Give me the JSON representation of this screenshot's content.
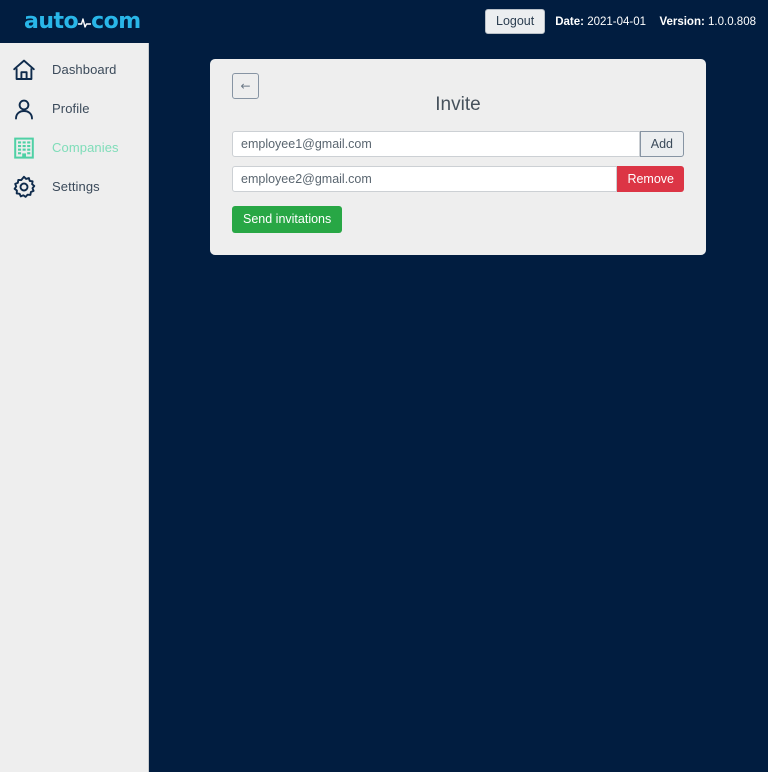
{
  "header": {
    "logo": {
      "text_left": "auto",
      "text_right": "com",
      "icon": "wave-pulse-icon",
      "color": "#29b6e8"
    },
    "logout_label": "Logout",
    "date_label": "Date:",
    "date_value": "2021-04-01",
    "version_label": "Version:",
    "version_value": "1.0.0.808"
  },
  "sidebar": {
    "items": [
      {
        "label": "Dashboard",
        "icon": "home-icon",
        "active": false
      },
      {
        "label": "Profile",
        "icon": "user-icon",
        "active": false
      },
      {
        "label": "Companies",
        "icon": "building-icon",
        "active": true
      },
      {
        "label": "Settings",
        "icon": "gear-icon",
        "active": false
      }
    ],
    "active_color": "#7fddb9",
    "inactive_color": "#3b4a5a"
  },
  "card": {
    "back_button_label": "←",
    "title": "Invite",
    "rows": [
      {
        "value": "employee1@gmail.com",
        "placeholder": "employee1@gmail.com",
        "button_label": "Add",
        "button_kind": "add"
      },
      {
        "value": "employee2@gmail.com",
        "placeholder": "employee2@gmail.com",
        "button_label": "Remove",
        "button_kind": "remove"
      }
    ],
    "send_label": "Send invitations"
  },
  "colors": {
    "page_background": "#011d40",
    "sidebar_background": "#eeeeee",
    "card_background": "#eeeeee",
    "accent_green": "#28a745",
    "danger_red": "#dc3545",
    "brand_cyan": "#29b6e8"
  }
}
